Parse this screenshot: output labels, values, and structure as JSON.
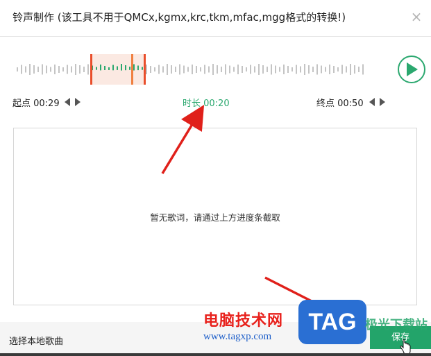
{
  "dialog": {
    "title": "铃声制作 (该工具不用于QMCx,kgmx,krc,tkm,mfac,mgg格式的转换!)",
    "close_glyph": "×"
  },
  "trim": {
    "start_label": "起点 00:29",
    "duration_label": "时长 00:20",
    "end_label": "终点 00:50",
    "accent_color": "#2ba86f",
    "marker_color": "#e94e2b"
  },
  "lyrics": {
    "empty_text": "暂无歌词，请通过上方进度条截取"
  },
  "footer": {
    "choose_local": "选择本地歌曲",
    "save_label": "保存"
  },
  "watermark": {
    "cn_text": "电脑技术网",
    "url_text": "www.tagxp.com",
    "tag_text": "TAG",
    "site_text": "极光下载站"
  }
}
